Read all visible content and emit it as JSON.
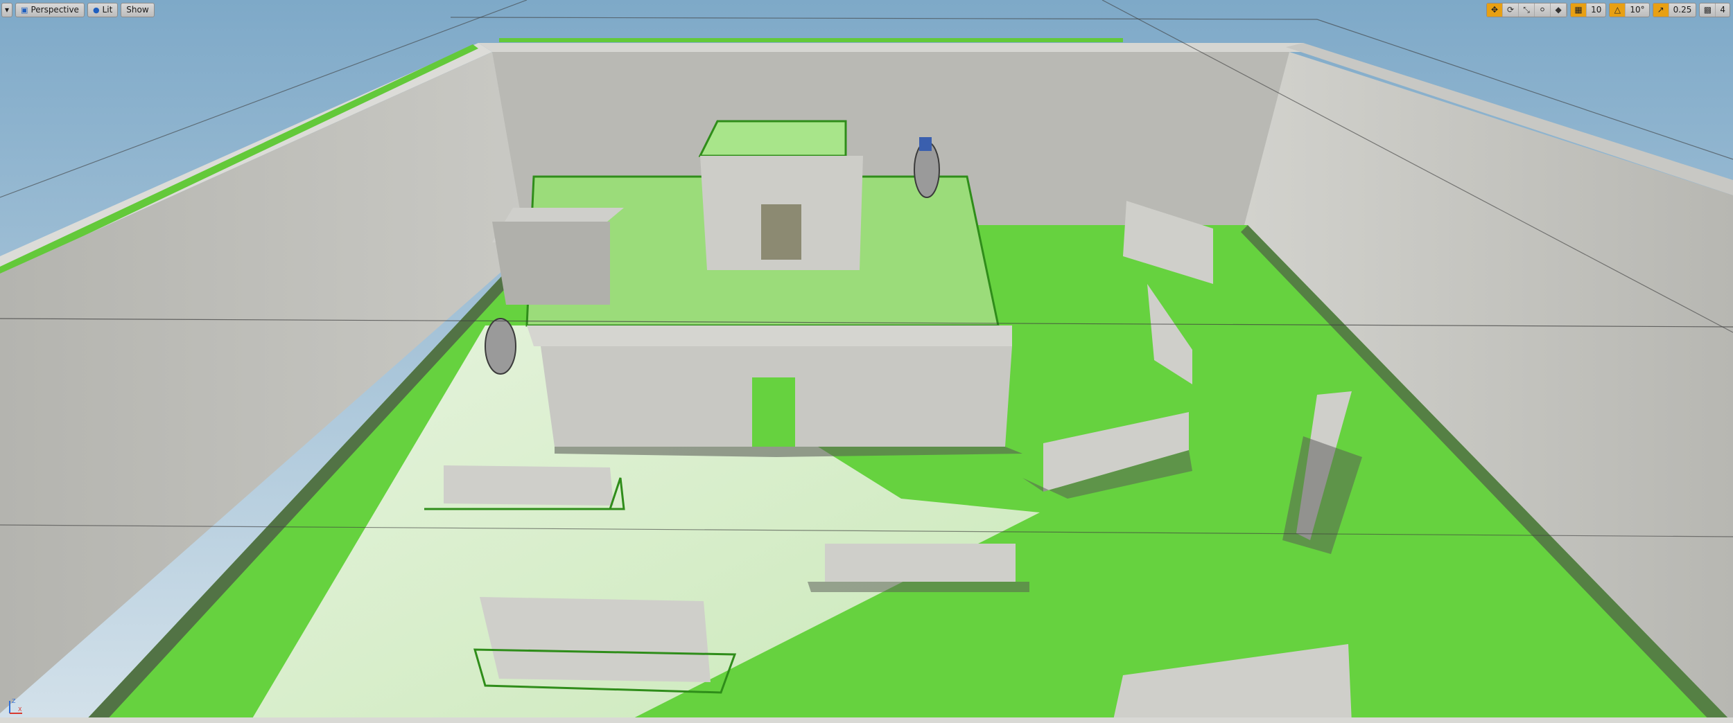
{
  "viewport": {
    "view_mode_label": "Perspective",
    "lighting_label": "Lit",
    "show_label": "Show",
    "menu_icon": "chevron-down-icon",
    "transform_tools": [
      "translate-icon",
      "rotate-icon",
      "scale-icon"
    ],
    "coordinate_space_icon": "world-globe-icon",
    "surface_snap_icon": "surface-snap-icon",
    "grid_snap_value": "10",
    "rotation_snap_value": "10°",
    "scale_snap_value": "0.25",
    "camera_speed_value": "4",
    "axis_labels": {
      "z": "Z",
      "x": "X"
    }
  },
  "colors": {
    "sky_top": "#7ea9c8",
    "sky_bottom": "#d3e1ea",
    "floor_green": "#66d23f",
    "floor_light": "#e9f2e2",
    "wall_grey": "#bdbdb8",
    "wall_dark": "#8c8c88",
    "snap_active": "#e8a013",
    "selection_outline": "#2f8d1a"
  }
}
